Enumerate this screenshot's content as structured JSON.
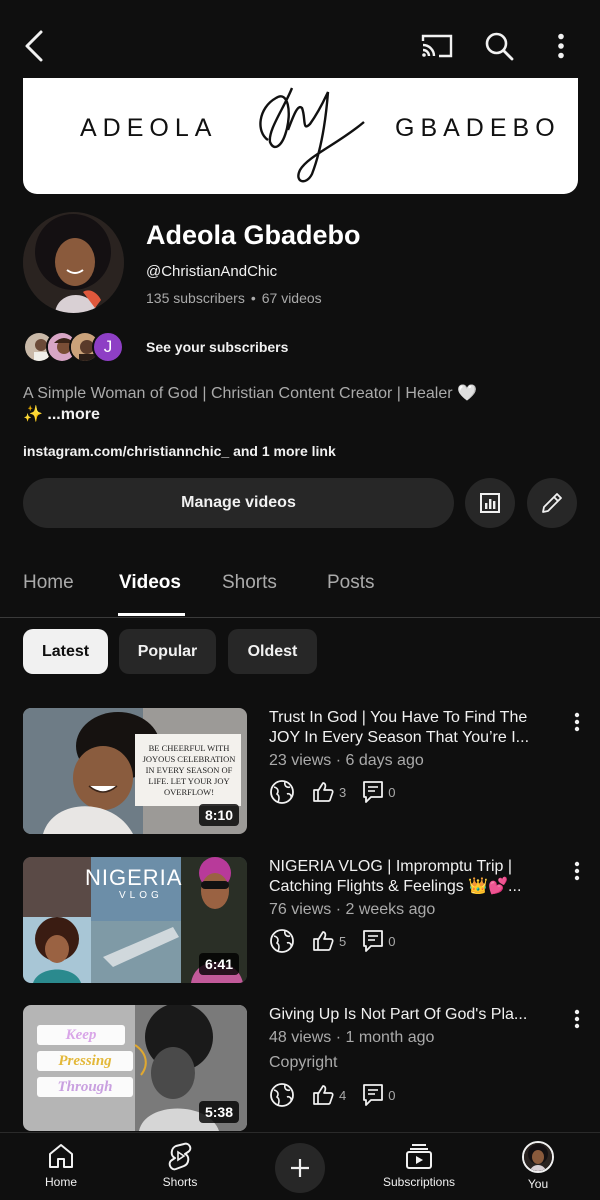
{
  "header": {
    "icons": [
      "back-arrow-icon",
      "cast-icon",
      "search-icon",
      "more-vert-icon"
    ]
  },
  "banner": {
    "left_text": "ADEOLA",
    "right_text": "GBADEBO"
  },
  "channel": {
    "name": "Adeola Gbadebo",
    "handle": "@ChristianAndChic",
    "subscribers": "135 subscribers",
    "videos_count": "67 videos",
    "subscriber_avatar_letter": "J",
    "see_subscribers_label": "See your subscribers",
    "description": "A Simple Woman of God | Christian Content Creator | Healer 🤍",
    "description_emoji": "✨",
    "more_label": "...more",
    "link": "instagram.com/christiannchic_ and 1 more link"
  },
  "actions": {
    "manage_label": "Manage videos"
  },
  "tabs": [
    {
      "label": "Home",
      "active": false
    },
    {
      "label": "Videos",
      "active": true
    },
    {
      "label": "Shorts",
      "active": false
    },
    {
      "label": "Posts",
      "active": false
    }
  ],
  "filters": [
    {
      "label": "Latest",
      "selected": true
    },
    {
      "label": "Popular",
      "selected": false
    },
    {
      "label": "Oldest",
      "selected": false
    }
  ],
  "videos": [
    {
      "title": "Trust In God | You Have To Find The JOY In Every Season That You’re I...",
      "meta": "23 views · 6 days ago",
      "extra": "",
      "likes": "3",
      "comments": "0",
      "duration": "8:10",
      "thumb_text": "BE CHEERFUL WITH JOYOUS CELEBRATION IN EVERY SEASON OF LIFE. LET YOUR JOY OVERFLOW!"
    },
    {
      "title": "NIGERIA VLOG | Impromptu Trip | Catching Flights & Feelings 👑💕...",
      "meta": "76 views · 2 weeks ago",
      "extra": "",
      "likes": "5",
      "comments": "0",
      "duration": "6:41",
      "thumb_text": "NIGERIA",
      "thumb_subtext": "VLOG"
    },
    {
      "title": "Giving Up Is Not Part Of God's Pla...",
      "meta": "48 views · 1 month ago",
      "extra": "Copyright",
      "likes": "4",
      "comments": "0",
      "duration": "5:38",
      "thumb_lines": [
        "Keep",
        "Pressing",
        "Through"
      ]
    }
  ],
  "bottom_nav": {
    "home": "Home",
    "shorts": "Shorts",
    "subscriptions": "Subscriptions",
    "you": "You"
  },
  "colors": {
    "background": "#0f0f0f",
    "surface": "#272727",
    "text_primary": "#f1f1f1",
    "text_secondary": "#aaaaaa"
  }
}
